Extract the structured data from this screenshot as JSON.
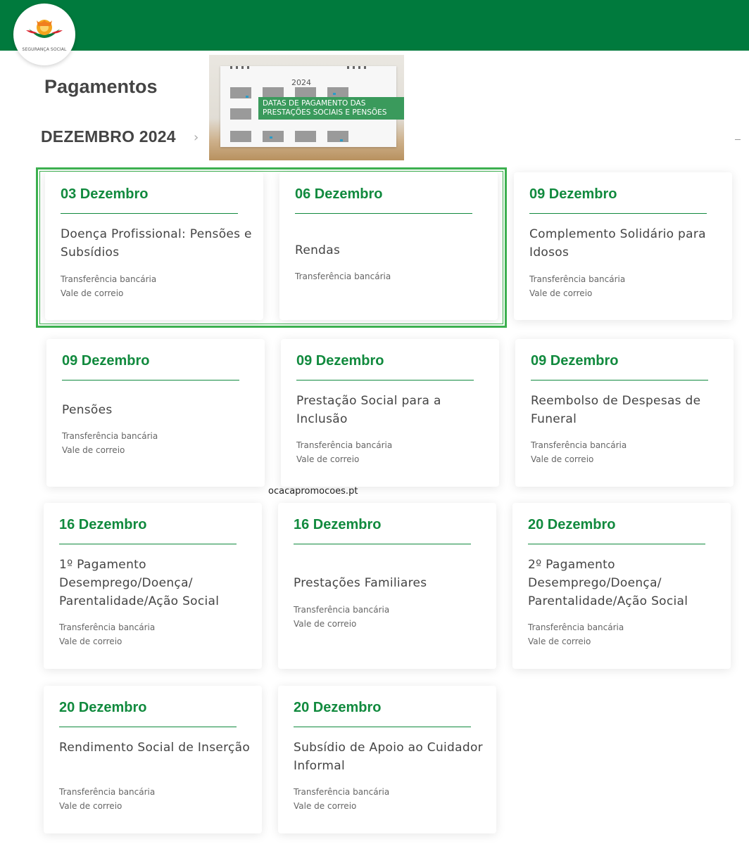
{
  "header": {
    "logo_text": "SEGURANÇA SOCIAL",
    "brand_color": "#007a3d"
  },
  "page": {
    "title": "Pagamentos",
    "month": "DEZEMBRO 2024",
    "chevron_icon": "chevron-right-icon"
  },
  "banner": {
    "year": "2024",
    "label_line1": "DATAS DE PAGAMENTO DAS",
    "label_line2": "PRESTAÇÕES SOCIAIS E PENSÕES"
  },
  "cards": [
    {
      "date": "03 Dezembro",
      "title": "Doença Profissional: Pensões e Subsídios",
      "methods": [
        "Transferência bancária",
        "Vale de correio"
      ]
    },
    {
      "date": "06 Dezembro",
      "title": "Rendas",
      "methods": [
        "Transferência bancária"
      ]
    },
    {
      "date": "09 Dezembro",
      "title": "Complemento Solidário para Idosos",
      "methods": [
        "Transferência bancária",
        "Vale de correio"
      ]
    },
    {
      "date": "09 Dezembro",
      "title": "Pensões",
      "methods": [
        "Transferência bancária",
        "Vale de correio"
      ]
    },
    {
      "date": "09 Dezembro",
      "title": "Prestação Social para a Inclusão",
      "methods": [
        "Transferência bancária",
        "Vale de correio"
      ]
    },
    {
      "date": "09 Dezembro",
      "title": "Reembolso de Despesas de Funeral",
      "methods": [
        "Transferência bancária",
        "Vale de correio"
      ]
    },
    {
      "date": "16 Dezembro",
      "title": "1º Pagamento Desemprego/Doença/ Parentalidade/Ação Social",
      "methods": [
        "Transferência bancária",
        "Vale de correio"
      ]
    },
    {
      "date": "16 Dezembro",
      "title": "Prestações Familiares",
      "methods": [
        "Transferência bancária",
        "Vale de correio"
      ]
    },
    {
      "date": "20 Dezembro",
      "title": "2º Pagamento Desemprego/Doença/ Parentalidade/Ação Social",
      "methods": [
        "Transferência bancária",
        "Vale de correio"
      ]
    },
    {
      "date": "20 Dezembro",
      "title": "Rendimento Social de Inserção",
      "methods": [
        "Transferência bancária",
        "Vale de correio"
      ]
    },
    {
      "date": "20 Dezembro",
      "title": "Subsídio de Apoio ao Cuidador Informal",
      "methods": [
        "Transferência bancária",
        "Vale de correio"
      ]
    }
  ],
  "watermark": "ocacapromocoes.pt",
  "colors": {
    "accent_green": "#118a3e",
    "highlight_green": "#3cb04f",
    "text_gray": "#444444"
  }
}
